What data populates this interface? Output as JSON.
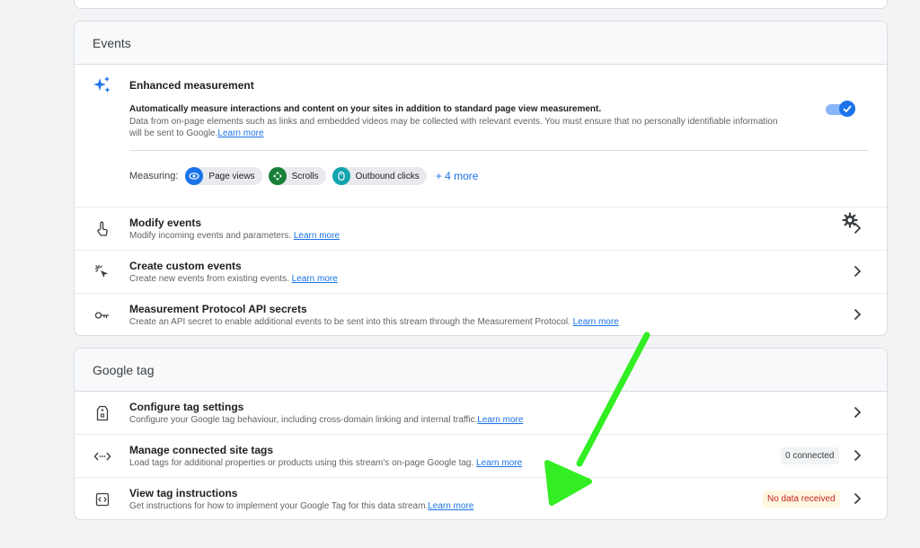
{
  "events": {
    "header": "Events",
    "enhanced": {
      "title": "Enhanced measurement",
      "line1": "Automatically measure interactions and content on your sites in addition to standard page view measurement.",
      "line2": "Data from on-page elements such as links and embedded videos may be collected with relevant events. You must ensure that no personally identifiable information",
      "line3": "will be sent to Google.",
      "learn": "Learn more",
      "measuring_label": "Measuring:",
      "chips": [
        "Page views",
        "Scrolls",
        "Outbound clicks"
      ],
      "more": "+ 4 more",
      "toggle_on": true
    },
    "rows": [
      {
        "title": "Modify events",
        "desc": "Modify incoming events and parameters.",
        "learn": "Learn more"
      },
      {
        "title": "Create custom events",
        "desc": "Create new events from existing events.",
        "learn": "Learn more"
      },
      {
        "title": "Measurement Protocol API secrets",
        "desc": "Create an API secret to enable additional events to be sent into this stream through the Measurement Protocol.",
        "learn": "Learn more"
      }
    ]
  },
  "google_tag": {
    "header": "Google tag",
    "rows": [
      {
        "title": "Configure tag settings",
        "desc": "Configure your Google tag behaviour, including cross-domain linking and internal traffic.",
        "learn": "Learn more"
      },
      {
        "title": "Manage connected site tags",
        "desc": "Load tags for additional properties or products using this stream's on-page Google tag.",
        "learn": "Learn more",
        "badge": "0 connected"
      },
      {
        "title": "View tag instructions",
        "desc": "Get instructions for how to implement your Google Tag for this data stream.",
        "learn": "Learn more",
        "badge": "No data received"
      }
    ]
  },
  "colors": {
    "accent": "#1a73e8",
    "chip_page_views": "#1a73e8",
    "chip_scrolls": "#188038",
    "chip_outbound": "#12a4af",
    "annotation_arrow": "#33ee22",
    "no_data_bg": "#fef7e0",
    "no_data_text": "#c5221f"
  }
}
